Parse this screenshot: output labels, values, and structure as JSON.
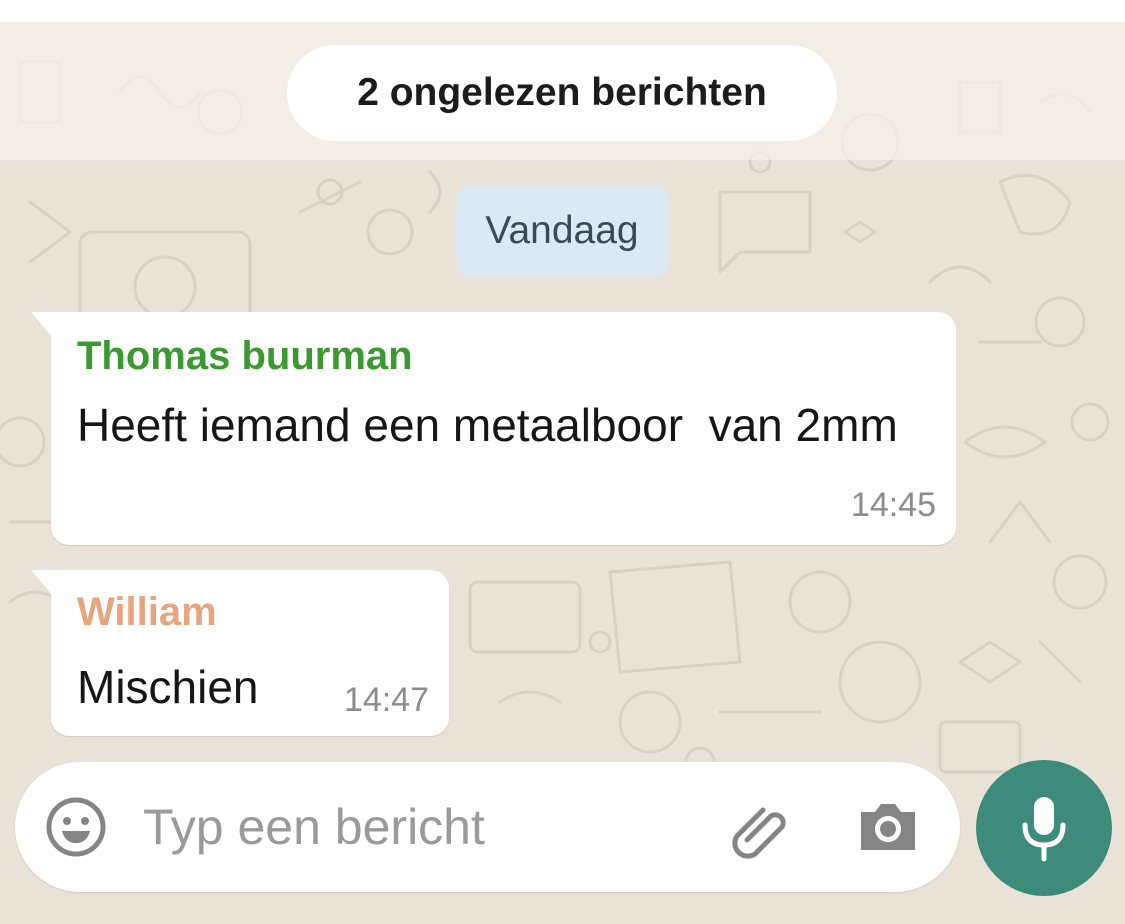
{
  "unread_banner": {
    "text": "2 ongelezen berichten"
  },
  "date_divider": {
    "text": "Vandaag"
  },
  "messages": [
    {
      "sender": "Thomas buurman",
      "text": "Heeft iemand een metaalboor  van 2mm",
      "time": "14:45",
      "sender_color": "#3b9a2f"
    },
    {
      "sender": "William",
      "text": "Mischien",
      "time": "14:47",
      "sender_color": "#e8a47d"
    }
  ],
  "composer": {
    "placeholder": "Typ een bericht",
    "emoji_icon": "smiley-icon",
    "attach_icon": "paperclip-icon",
    "camera_icon": "camera-icon",
    "mic_icon": "microphone-icon"
  },
  "colors": {
    "chat_background": "#e9e2d7",
    "date_chip": "#d9eaf4",
    "mic_button": "#3d8c7b"
  }
}
